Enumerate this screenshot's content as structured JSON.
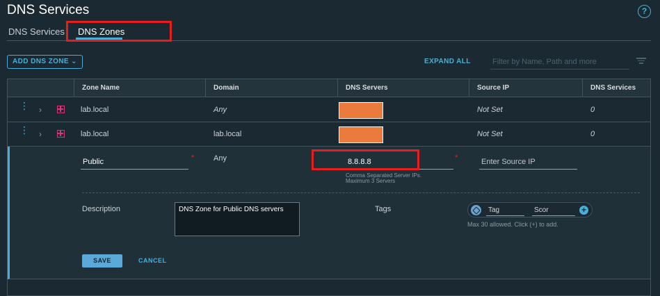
{
  "header": {
    "title": "DNS Services",
    "help_glyph": "?"
  },
  "tabs": [
    {
      "label": "DNS Services",
      "active": false
    },
    {
      "label": "DNS Zones",
      "active": true
    }
  ],
  "toolbar": {
    "add_label": "ADD DNS ZONE",
    "add_chevron": "⌄",
    "expand_all_label": "EXPAND ALL",
    "filter_placeholder": "Filter by Name, Path and more"
  },
  "table": {
    "columns": [
      "Zone Name",
      "Domain",
      "DNS Servers",
      "Source IP",
      "DNS Services"
    ],
    "rows": [
      {
        "zone_name": "lab.local",
        "domain": "Any",
        "dns_servers_redacted": true,
        "source_ip": "Not Set",
        "dns_services": "0"
      },
      {
        "zone_name": "lab.local",
        "domain": "lab.local",
        "dns_servers_redacted": true,
        "source_ip": "Not Set",
        "dns_services": "0"
      }
    ]
  },
  "edit": {
    "name_value": "Public",
    "required_mark": "*",
    "domain_value": "Any",
    "dns_servers_value": "8.8.8.8",
    "dns_servers_helper_1": "Comma Separated Server IPs.",
    "dns_servers_helper_2": "Maximum 3 Servers",
    "source_ip_placeholder": "Enter Source IP",
    "description_label": "Description",
    "description_value": "DNS Zone for Public DNS servers",
    "tags_label": "Tags",
    "tag_placeholder": "Tag",
    "scope_placeholder": "Scor",
    "tags_helper": "Max 30 allowed. Click (+) to add.",
    "save_label": "SAVE",
    "cancel_label": "CANCEL"
  },
  "icons": {
    "kebab": "⋮",
    "chevron_right": "›",
    "add_tag": "+"
  },
  "colors": {
    "accent": "#49afd9",
    "highlight": "#e61e1e",
    "redaction": "#ea7b3c",
    "zone_icon": "#d3387c",
    "required": "#e62700"
  }
}
